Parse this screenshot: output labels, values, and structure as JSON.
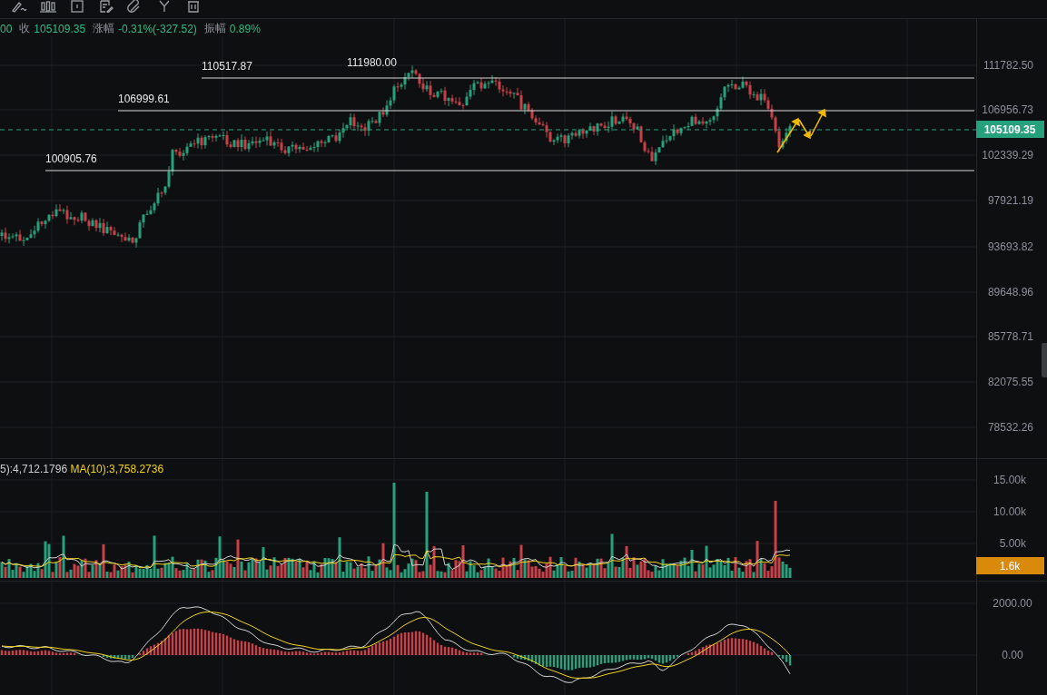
{
  "quote_bar": [
    {
      "kind": "value",
      "text": "00"
    },
    {
      "kind": "label",
      "text": "收"
    },
    {
      "kind": "value",
      "text": "105109.35"
    },
    {
      "kind": "label",
      "text": "涨幅"
    },
    {
      "kind": "value",
      "text": "-0.31%(-327.52)"
    },
    {
      "kind": "label",
      "text": "振幅"
    },
    {
      "kind": "value",
      "text": "0.89%"
    }
  ],
  "price_chart": {
    "level_lines": [
      {
        "label": "110517.87"
      },
      {
        "label": "106999.61"
      },
      {
        "label": "100905.76"
      }
    ],
    "high_marker": {
      "label": "111980.00"
    },
    "axis_labels": [
      "111782.50",
      "106956.73",
      "102339.29",
      "97921.19",
      "93693.82",
      "89648.96",
      "85778.71",
      "82075.55",
      "78532.26"
    ],
    "current_price": "105109.35"
  },
  "volume_pane": {
    "legend": [
      {
        "text": "5):4,712.1796",
        "color": "#c9ccd1"
      },
      {
        "text": "MA(10):3,758.2736",
        "color": "#f0d21c"
      }
    ],
    "axis_labels": [
      "15.00k",
      "10.00k",
      "5.00k"
    ],
    "current_volume": "1.6k"
  },
  "macd_pane": {
    "axis_labels": [
      "2000.00",
      "0.00"
    ]
  }
}
